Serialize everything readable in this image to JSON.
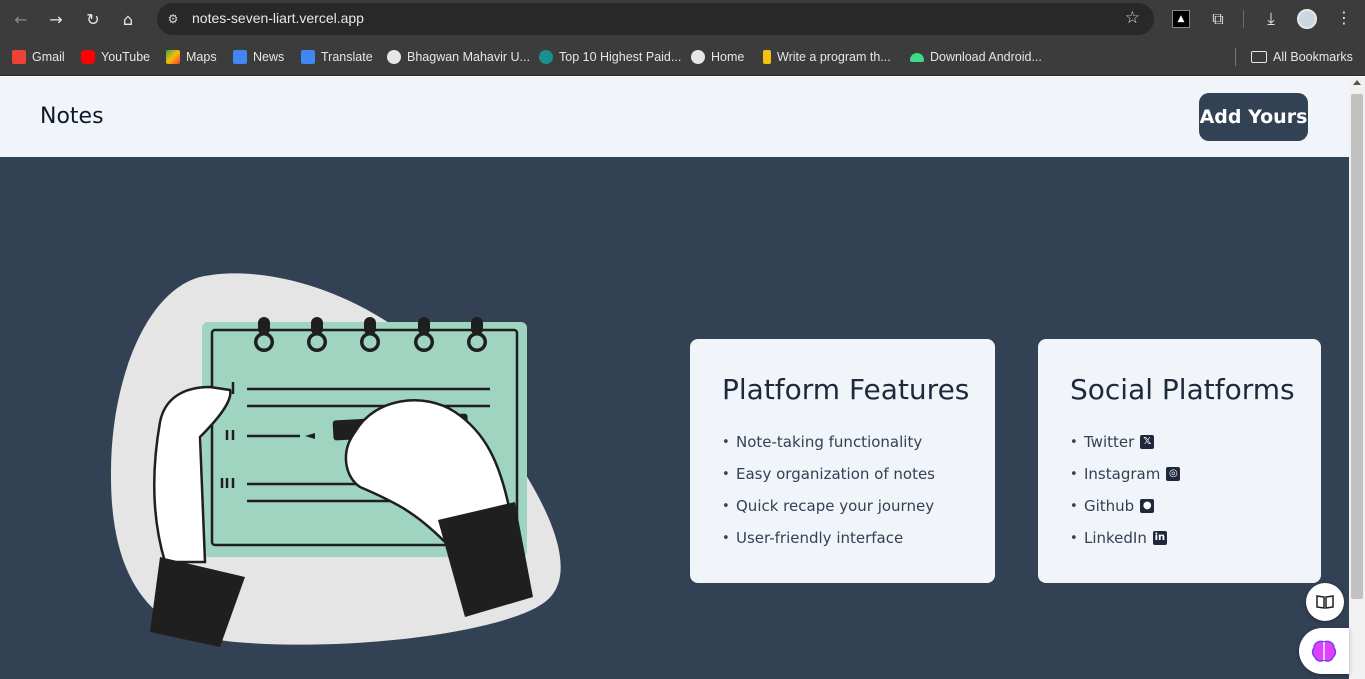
{
  "browser": {
    "url": "notes-seven-liart.vercel.app",
    "ext_label": "▲",
    "bookmarks": [
      {
        "label": "Gmail",
        "icon": "gmail-icon",
        "color": "#ea4335"
      },
      {
        "label": "YouTube",
        "icon": "youtube-icon",
        "color": "#ff0000"
      },
      {
        "label": "Maps",
        "icon": "maps-icon",
        "color": "#34a853"
      },
      {
        "label": "News",
        "icon": "news-icon",
        "color": "#4285f4"
      },
      {
        "label": "Translate",
        "icon": "translate-icon",
        "color": "#4285f4"
      },
      {
        "label": "Bhagwan Mahavir U...",
        "icon": "globe-icon",
        "color": "#e6e6e6"
      },
      {
        "label": "Top 10 Highest Paid...",
        "icon": "site-icon",
        "color": "#1a8f8f"
      },
      {
        "label": "Home",
        "icon": "globe-icon",
        "color": "#e6e6e6"
      },
      {
        "label": "Write a program th...",
        "icon": "site-icon",
        "color": "#f4c20d"
      },
      {
        "label": "Download Android...",
        "icon": "android-icon",
        "color": "#3ddc84"
      }
    ],
    "all_bookmarks": "All Bookmarks"
  },
  "header": {
    "brand": "Notes",
    "add_button": "Add Yours"
  },
  "features": {
    "title": "Platform Features",
    "items": [
      "Note-taking functionality",
      "Easy organization of notes",
      "Quick recape your journey",
      "User-friendly interface"
    ]
  },
  "social": {
    "title": "Social Platforms",
    "items": [
      {
        "label": "Twitter",
        "icon": "x-icon",
        "glyph": "𝕏"
      },
      {
        "label": "Instagram",
        "icon": "instagram-icon",
        "glyph": "◎"
      },
      {
        "label": "Github",
        "icon": "github-icon",
        "glyph": "●"
      },
      {
        "label": "LinkedIn",
        "icon": "linkedin-icon",
        "glyph": "in"
      }
    ]
  },
  "colors": {
    "page_bg": "#334155",
    "header_bg": "#f1f5f9",
    "card_bg": "#f1f5f9",
    "notepad": "#9fd4c0"
  }
}
